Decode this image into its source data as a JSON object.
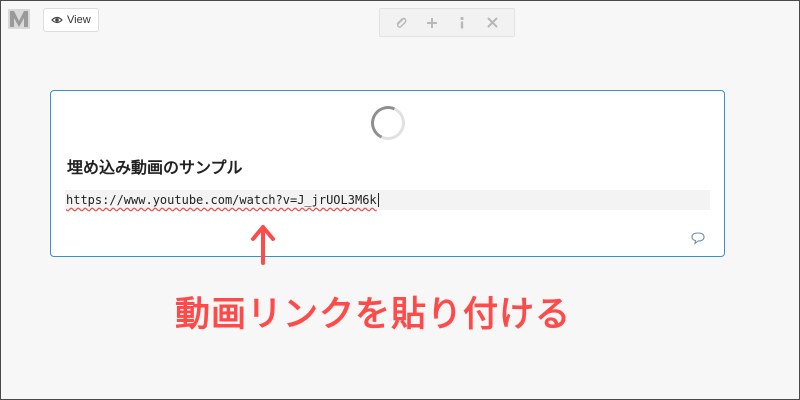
{
  "header": {
    "logo": "medium-logo-icon",
    "view_button": {
      "label": "View",
      "icon": "eye-icon"
    }
  },
  "toolbar": {
    "tools": [
      {
        "icon": "attachment-icon",
        "glyph": "📎"
      },
      {
        "icon": "plus-icon",
        "glyph": "✚"
      },
      {
        "icon": "info-icon",
        "glyph": "ⅰ"
      },
      {
        "icon": "close-icon",
        "glyph": "✖"
      }
    ]
  },
  "card": {
    "loading_icon": "spinner-icon",
    "title": "埋め込み動画のサンプル",
    "url_value": "https://www.youtube.com/watch?v=J_jrUOL3M6k",
    "comment_icon": "comment-icon"
  },
  "annotation": {
    "arrow_icon": "arrow-up-icon",
    "text": "動画リンクを貼り付ける",
    "color": "#ff4a4a"
  },
  "colors": {
    "card_border": "#3a8fd0",
    "background": "#f7f7f7"
  }
}
